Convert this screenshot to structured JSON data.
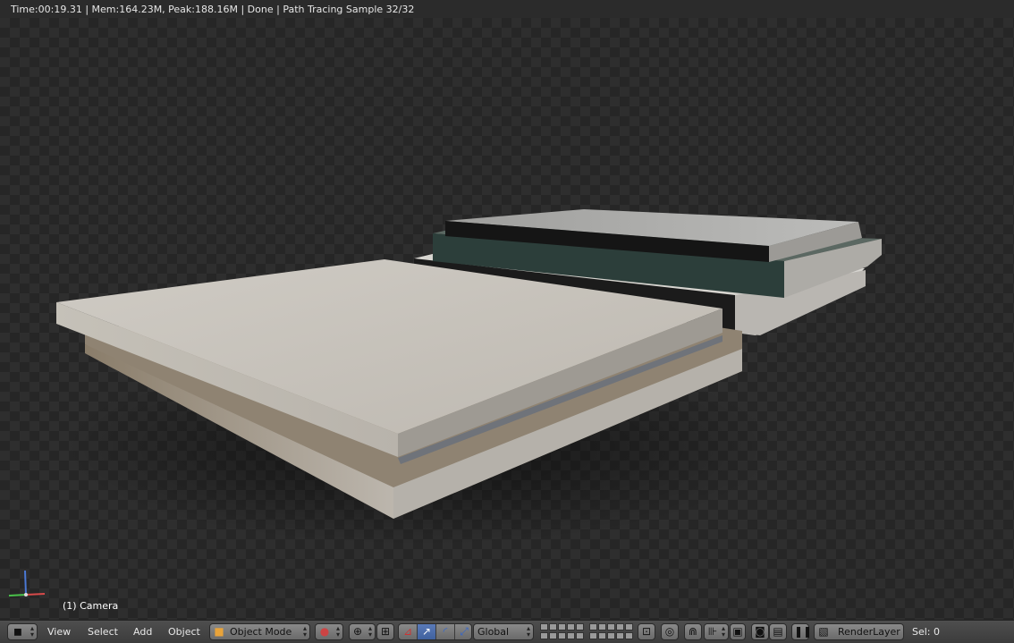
{
  "status_bar": {
    "text": "Time:00:19.31 | Mem:164.23M, Peak:188.16M | Done | Path Tracing Sample 32/32"
  },
  "viewport": {
    "view_name": "(1) Camera"
  },
  "header": {
    "menus": [
      "View",
      "Select",
      "Add",
      "Object"
    ],
    "mode_label": "Object Mode",
    "orientation_label": "Global",
    "render_layer_label": "RenderLayer",
    "selection_text": "Sel: 0"
  },
  "icons": [
    "editor-type-cube-icon",
    "viewport-shading-sphere-icon",
    "pivot-point-icon",
    "transform-manipulator-icon",
    "translate-icon",
    "rotate-icon",
    "scale-icon",
    "proportional-editing-icon",
    "snap-icon",
    "render-camera-icon",
    "clapboard-icon"
  ],
  "colors": {
    "header_bg": "#474747",
    "active_button": "#5473b0",
    "viewport_bg": "#2e2e2e"
  }
}
